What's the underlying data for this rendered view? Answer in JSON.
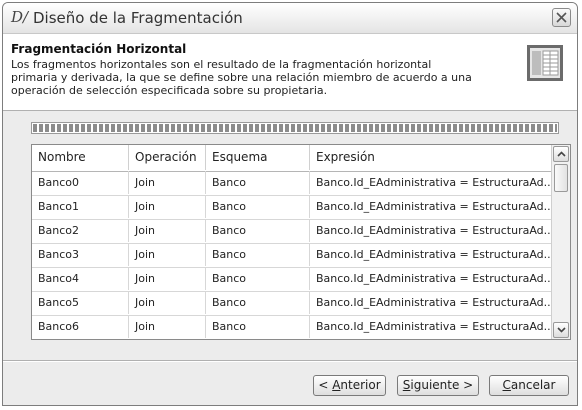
{
  "window": {
    "app_icon_glyph": "D/",
    "title": "Diseño de la Fragmentación"
  },
  "header": {
    "title": "Fragmentación Horizontal",
    "description": "Los fragmentos horizontales son el resultado de la fragmentación horizontal primaria y derivada, la que se define sobre una relación miembro de acuerdo a una operación de selección especificada sobre su propietaria."
  },
  "progress": {
    "value": 1.0
  },
  "table": {
    "columns": [
      "Nombre",
      "Operación",
      "Esquema",
      "Expresión"
    ],
    "rows": [
      [
        "Banco0",
        "Join",
        "Banco",
        "Banco.Id_EAdministrativa = EstructuraAd..."
      ],
      [
        "Banco1",
        "Join",
        "Banco",
        "Banco.Id_EAdministrativa = EstructuraAd..."
      ],
      [
        "Banco2",
        "Join",
        "Banco",
        "Banco.Id_EAdministrativa = EstructuraAd..."
      ],
      [
        "Banco3",
        "Join",
        "Banco",
        "Banco.Id_EAdministrativa = EstructuraAd..."
      ],
      [
        "Banco4",
        "Join",
        "Banco",
        "Banco.Id_EAdministrativa = EstructuraAd..."
      ],
      [
        "Banco5",
        "Join",
        "Banco",
        "Banco.Id_EAdministrativa = EstructuraAd..."
      ],
      [
        "Banco6",
        "Join",
        "Banco",
        "Banco.Id_EAdministrativa = EstructuraAd..."
      ]
    ]
  },
  "buttons": {
    "prev_prefix": "< ",
    "prev_mnemonic": "A",
    "prev_rest": "nterior",
    "next_mnemonic": "S",
    "next_rest": "iguiente >",
    "cancel_mnemonic": "C",
    "cancel_rest": "ancelar"
  },
  "icons": {
    "app": "designer-app-icon",
    "close": "close-icon",
    "header": "table-fragment-icon",
    "scroll_up": "chevron-up-icon",
    "scroll_down": "chevron-down-icon"
  }
}
